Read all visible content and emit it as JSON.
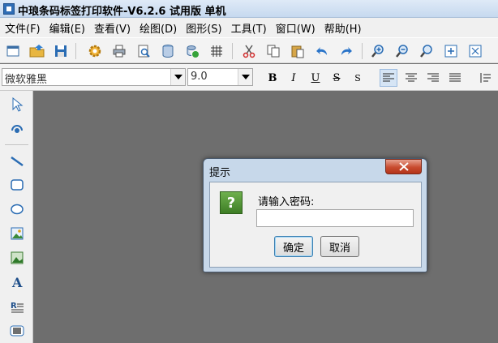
{
  "window": {
    "title": "中琅条码标签打印软件-V6.2.6 试用版 单机"
  },
  "menu": [
    "文件(F)",
    "编辑(E)",
    "查看(V)",
    "绘图(D)",
    "图形(S)",
    "工具(T)",
    "窗口(W)",
    "帮助(H)"
  ],
  "toolbar": {
    "buttons": [
      "new-icon",
      "open-icon",
      "save-icon",
      "settings-icon",
      "print-icon",
      "print-preview-icon",
      "database-icon",
      "data-link-icon",
      "grid-icon",
      "cut-icon",
      "copy-icon",
      "paste-icon",
      "undo-icon",
      "redo-icon",
      "zoom-in-icon",
      "zoom-out-icon",
      "zoom-fit-icon",
      "fit-page-icon",
      "actual-size-icon"
    ]
  },
  "format": {
    "font": "微软雅黑",
    "size": "9.0",
    "bold": "B",
    "italic": "I",
    "underline": "U",
    "strike": "S",
    "spacing": "S"
  },
  "dialog": {
    "title": "提示",
    "prompt": "请输入密码:",
    "password": "",
    "ok": "确定",
    "cancel": "取消"
  },
  "colors": {
    "workspace": "#6e6e6e",
    "dialog_frame": "#c7d8ea",
    "close_button": "#c84b2f",
    "question_icon": "#4e9a35"
  }
}
